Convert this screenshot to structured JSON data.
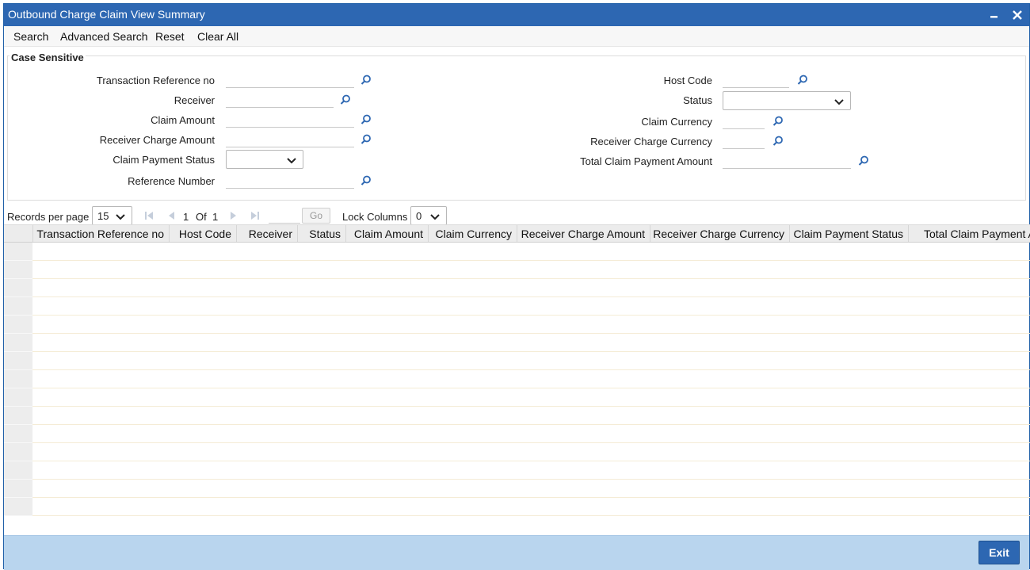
{
  "window": {
    "title": "Outbound Charge Claim View Summary"
  },
  "toolbar": {
    "search": "Search",
    "advanced_search": "Advanced Search",
    "reset": "Reset",
    "clear_all": "Clear All"
  },
  "panel": {
    "title": "Case Sensitive",
    "fields": {
      "transaction_reference_no": {
        "label": "Transaction Reference no",
        "value": ""
      },
      "receiver": {
        "label": "Receiver",
        "value": ""
      },
      "claim_amount": {
        "label": "Claim Amount",
        "value": ""
      },
      "receiver_charge_amount": {
        "label": "Receiver Charge Amount",
        "value": ""
      },
      "claim_payment_status": {
        "label": "Claim Payment Status",
        "value": ""
      },
      "reference_number": {
        "label": "Reference Number",
        "value": ""
      },
      "host_code": {
        "label": "Host Code",
        "value": ""
      },
      "status": {
        "label": "Status",
        "value": ""
      },
      "claim_currency": {
        "label": "Claim Currency",
        "value": ""
      },
      "receiver_charge_currency": {
        "label": "Receiver Charge Currency",
        "value": ""
      },
      "total_claim_payment_amount": {
        "label": "Total Claim Payment Amount",
        "value": ""
      }
    }
  },
  "pager": {
    "records_per_page_label": "Records per page",
    "records_per_page": "15",
    "current_page": "1",
    "of_label": "Of",
    "total_pages": "1",
    "go_label": "Go",
    "lock_columns_label": "Lock Columns",
    "lock_columns": "0"
  },
  "grid": {
    "columns": [
      "Transaction Reference no",
      "Host Code",
      "Receiver",
      "Status",
      "Claim Amount",
      "Claim Currency",
      "Receiver Charge Amount",
      "Receiver Charge Currency",
      "Claim Payment Status",
      "Total Claim Payment Amount"
    ]
  },
  "footer": {
    "exit": "Exit"
  },
  "colors": {
    "titlebar": "#2d67b2",
    "footer": "#b9d5ee",
    "search_icon": "#2d67b2"
  }
}
